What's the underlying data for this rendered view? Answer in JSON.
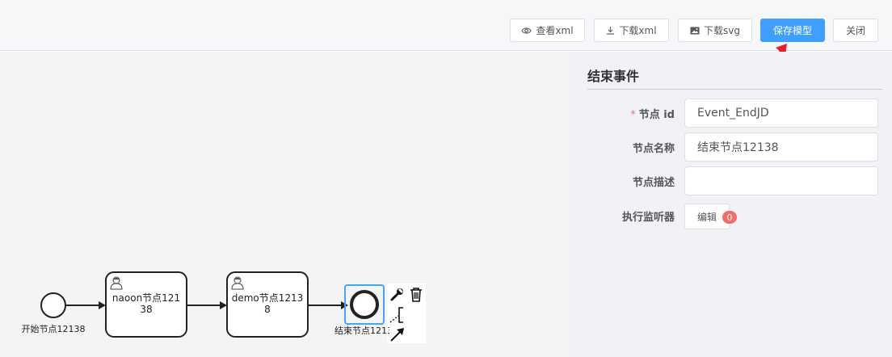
{
  "toolbar": {
    "view_xml": "查看xml",
    "download_xml": "下载xml",
    "download_svg": "下载svg",
    "save_model": "保存模型",
    "close": "关闭"
  },
  "diagram": {
    "start_event": "开始节点12138",
    "task1_line1": "naoon节点121",
    "task1_line2": "38",
    "task2_line1": "demo节点1213",
    "task2_line2": "8",
    "end_event": "结束节点1213"
  },
  "panel": {
    "title": "结束事件",
    "fields": {
      "id_label": "节点 id",
      "id_required_mark": "*",
      "id_value": "Event_EndJD",
      "name_label": "节点名称",
      "name_value": "结束节点12138",
      "desc_label": "节点描述",
      "desc_value": "",
      "listener_label": "执行监听器",
      "listener_edit": "编辑",
      "listener_count": "0"
    }
  },
  "colors": {
    "primary": "#409eff",
    "arrow_annotation": "#e5202a",
    "badge": "#f56c6c"
  },
  "icons": [
    "eye-icon",
    "download-icon",
    "image-icon",
    "user-task-icon",
    "wrench-icon",
    "trash-icon",
    "annotation-icon",
    "connect-arrow-icon"
  ]
}
